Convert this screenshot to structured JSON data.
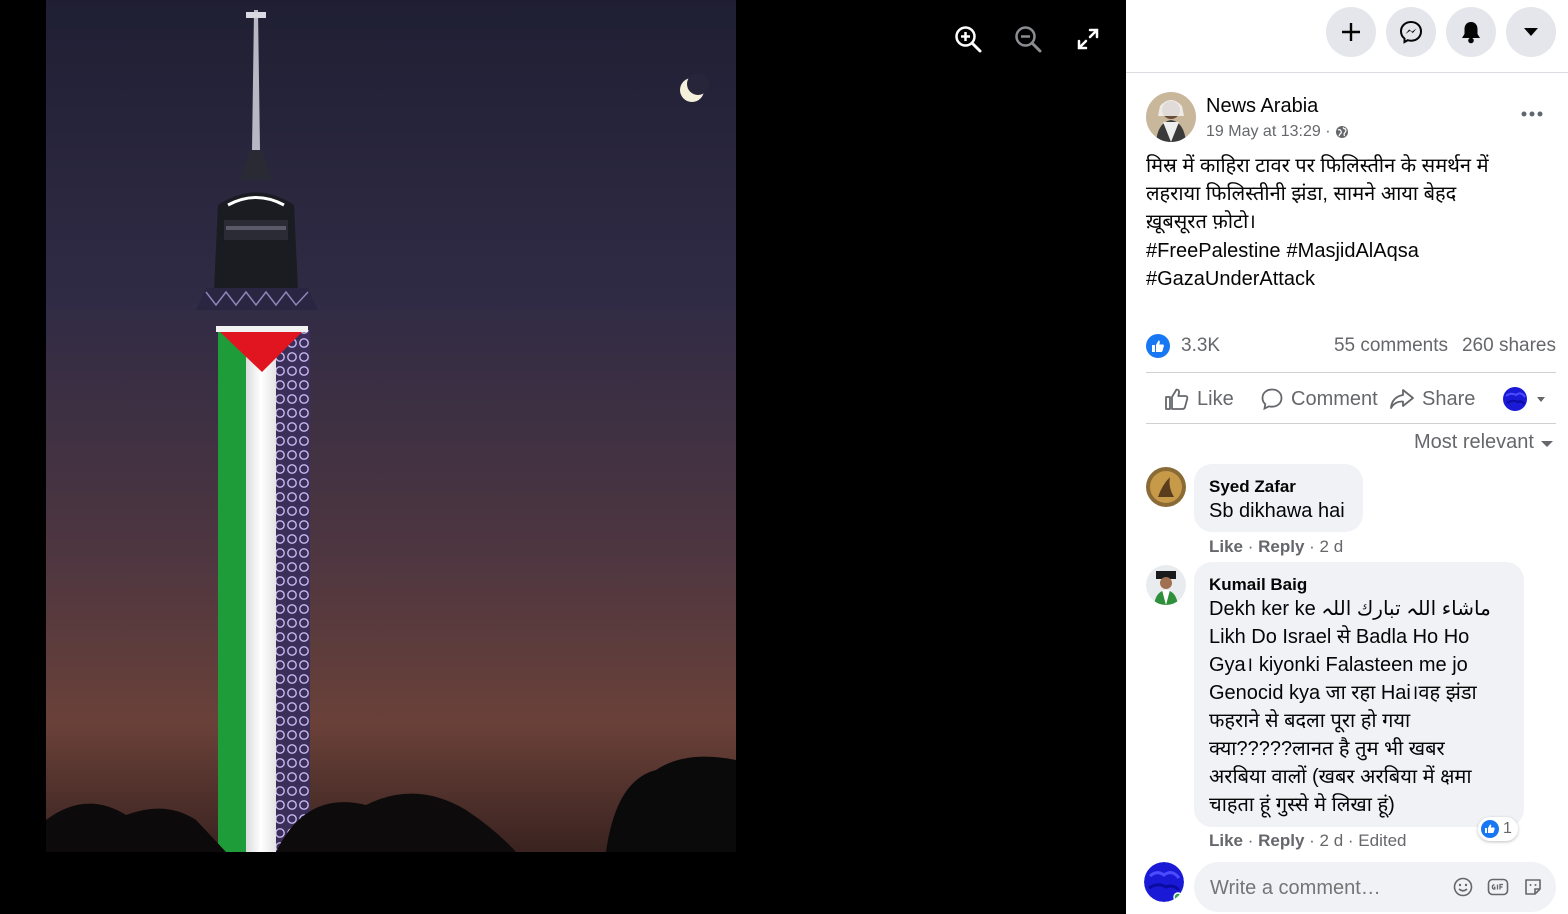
{
  "viewer": {
    "tools": [
      {
        "icon": "zoom-in-icon"
      },
      {
        "icon": "zoom-out-icon"
      },
      {
        "icon": "fullscreen-icon"
      }
    ]
  },
  "topbar": {
    "buttons": [
      {
        "icon": "plus-icon"
      },
      {
        "icon": "messenger-icon"
      },
      {
        "icon": "bell-icon"
      },
      {
        "icon": "caret-down-icon"
      }
    ]
  },
  "post": {
    "author": "News Arabia",
    "date": "19 May at 13:29 ·",
    "privacy_icon": "globe-icon",
    "text": "मिस्र में काहिरा टावर पर फिलिस्तीन के समर्थन में\nलहराया फिलिस्तीनी झंडा, सामने आया बेहद\nख़ूबसूरत फ़ोटो।",
    "hashtags": [
      "#FreePalestine",
      "#MasjidAlAqsa",
      "#GazaUnderAttack"
    ],
    "reactions_count": "3.3K",
    "comments_count": "55 comments",
    "shares_count": "260 shares"
  },
  "actions": {
    "like": "Like",
    "comment": "Comment",
    "share": "Share"
  },
  "sort_label": "Most relevant",
  "comments": [
    {
      "name": "Syed Zafar",
      "text": "Sb dikhawa hai",
      "like": "Like",
      "reply": "Reply",
      "meta": "· 2 d"
    },
    {
      "name": "Kumail Baig",
      "text": "Dekh ker ke ماشاء اللہ تبارك اللہ\nLikh Do Israel से Badla Ho Ho\nGya। kiyonki Falasteen me jo\nGenocid kya जा रहा Hai।वह झंडा\nफहराने से बदला पूरा हो गया\nक्या?????लानत है तुम भी खबर\nअरबिया वालों (खबर अरबिया में क्षमा\nचाहता हूं गुस्से मे लिखा हूं)",
      "like": "Like",
      "reply": "Reply",
      "meta": "· 2 d · Edited",
      "reactions": "1"
    }
  ],
  "composer": {
    "placeholder": "Write a comment…"
  },
  "colors": {
    "accent": "#1877f2",
    "bubble": "#f0f2f5",
    "muted": "#65676b",
    "flag_green": "#1f9c3a",
    "flag_red": "#e0151f",
    "sky_top": "#242437",
    "sky_bottom": "#6e433d"
  }
}
